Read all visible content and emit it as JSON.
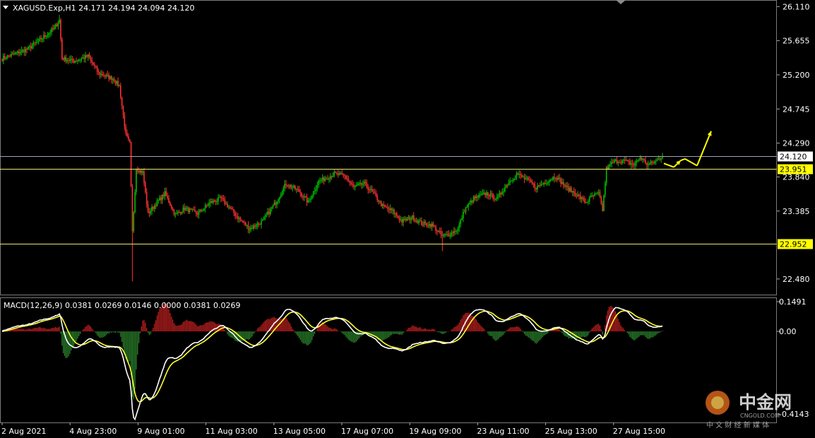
{
  "header": {
    "symbol_line": "XAGUSD.Exp,H1  24.171 24.194 24.094 24.120"
  },
  "indicator": {
    "label": "MACD(12,26,9) 0.0381 0.0269 0.0146 0.0000 0.0381 0.0269"
  },
  "watermark": {
    "brand": "中金网",
    "domain": "CNGOLD.COM",
    "tagline": "中 文 财 经 新 媒 体"
  },
  "colors": {
    "background": "#000000",
    "bull": "#00c000",
    "bear": "#ff3030",
    "level_line": "#e8e878",
    "bid_line": "#a0a0c0",
    "arrow": "#ffff00",
    "macd_main": "#ffffff",
    "macd_signal": "#ffff33",
    "hist_up": "#cc2222",
    "hist_down": "#2e8b2e"
  },
  "chart_data": [
    {
      "type": "candlestick",
      "ylim": [
        22.3,
        26.16
      ],
      "y_ticks": [
        "26.110",
        "25.655",
        "25.200",
        "24.745",
        "24.290",
        "23.840",
        "23.385",
        "22.480"
      ],
      "x_ticks": [
        "2 Aug 2021",
        "4 Aug 23:00",
        "9 Aug 01:00",
        "11 Aug 03:00",
        "13 Aug 05:00",
        "17 Aug 07:00",
        "19 Aug 09:00",
        "23 Aug 11:00",
        "25 Aug 13:00",
        "27 Aug 15:00"
      ],
      "current_price": "24.120",
      "levels": [
        {
          "value": 23.951,
          "label": "23.951"
        },
        {
          "value": 22.952,
          "label": "22.952"
        }
      ],
      "path_keypoints": [
        [
          0,
          25.42
        ],
        [
          10,
          25.48
        ],
        [
          20,
          25.55
        ],
        [
          30,
          25.68
        ],
        [
          40,
          25.82
        ],
        [
          44,
          25.93
        ],
        [
          46,
          25.42
        ],
        [
          55,
          25.38
        ],
        [
          66,
          25.45
        ],
        [
          74,
          25.22
        ],
        [
          85,
          25.15
        ],
        [
          90,
          25.05
        ],
        [
          95,
          24.4
        ],
        [
          98,
          24.28
        ],
        [
          100,
          23.1
        ],
        [
          103,
          23.95
        ],
        [
          108,
          23.9
        ],
        [
          112,
          23.35
        ],
        [
          118,
          23.48
        ],
        [
          125,
          23.62
        ],
        [
          133,
          23.33
        ],
        [
          140,
          23.42
        ],
        [
          150,
          23.35
        ],
        [
          160,
          23.5
        ],
        [
          168,
          23.55
        ],
        [
          176,
          23.4
        ],
        [
          182,
          23.28
        ],
        [
          190,
          23.15
        ],
        [
          200,
          23.25
        ],
        [
          210,
          23.5
        ],
        [
          218,
          23.75
        ],
        [
          228,
          23.65
        ],
        [
          235,
          23.5
        ],
        [
          243,
          23.78
        ],
        [
          255,
          23.88
        ],
        [
          263,
          23.85
        ],
        [
          270,
          23.7
        ],
        [
          278,
          23.75
        ],
        [
          286,
          23.6
        ],
        [
          292,
          23.45
        ],
        [
          300,
          23.38
        ],
        [
          307,
          23.25
        ],
        [
          315,
          23.3
        ],
        [
          322,
          23.22
        ],
        [
          330,
          23.2
        ],
        [
          338,
          23.05
        ],
        [
          344,
          23.08
        ],
        [
          350,
          23.15
        ],
        [
          355,
          23.4
        ],
        [
          362,
          23.55
        ],
        [
          372,
          23.62
        ],
        [
          380,
          23.55
        ],
        [
          388,
          23.75
        ],
        [
          395,
          23.88
        ],
        [
          403,
          23.8
        ],
        [
          410,
          23.7
        ],
        [
          418,
          23.78
        ],
        [
          425,
          23.85
        ],
        [
          433,
          23.7
        ],
        [
          440,
          23.62
        ],
        [
          448,
          23.5
        ],
        [
          453,
          23.58
        ],
        [
          458,
          23.62
        ],
        [
          461,
          23.4
        ],
        [
          464,
          23.95
        ],
        [
          470,
          24.05
        ],
        [
          478,
          24.05
        ],
        [
          485,
          24.0
        ],
        [
          490,
          24.1
        ],
        [
          496,
          24.0
        ],
        [
          502,
          24.05
        ],
        [
          507,
          24.12
        ]
      ],
      "arrow_path": [
        24.02,
        23.97,
        24.06,
        24.08,
        23.99,
        24.45
      ]
    },
    {
      "type": "macd",
      "fast": 12,
      "slow": 26,
      "signal": 9,
      "ylim": [
        -0.45,
        0.16
      ],
      "y_ticks": [
        "0.1491",
        "0.00",
        "-0.4143"
      ]
    }
  ]
}
